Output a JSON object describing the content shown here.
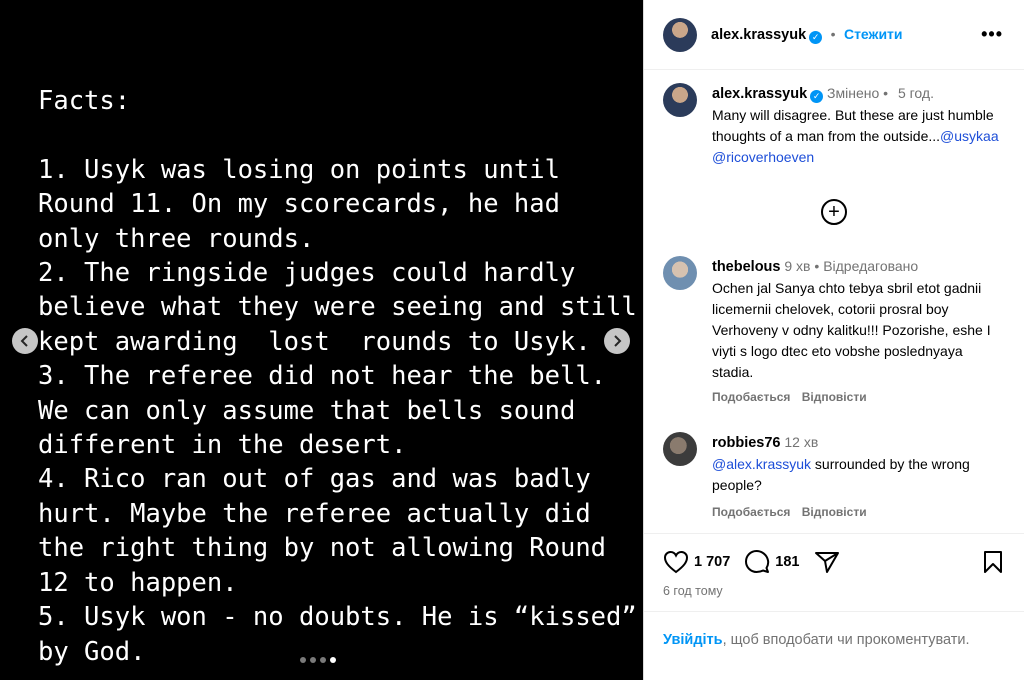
{
  "post_image": {
    "text": "Facts:\n\n1. Usyk was losing on points until\nRound 11. On my scorecards, he had\nonly three rounds.\n2. The ringside judges could hardly\nbelieve what they were seeing and still\nkept awarding  lost  rounds to Usyk.\n3. The referee did not hear the bell.\nWe can only assume that bells sound\ndifferent in the desert.\n4. Rico ran out of gas and was badly\nhurt. Maybe the referee actually did\nthe right thing by not allowing Round\n12 to happen.\n5. Usyk won - no doubts. He is “kissed”\nby God.",
    "carousel_dots": 4,
    "active_dot": 4
  },
  "header": {
    "username": "alex.krassyuk",
    "separator": "•",
    "follow_label": "Стежити",
    "more_label": "•••"
  },
  "caption": {
    "username": "alex.krassyuk",
    "edited": "Змінено",
    "separator": "•",
    "time": "5 год.",
    "text": "Many will disagree. But these are just humble thoughts of a man from the outside...",
    "mention_1": "@usykaa",
    "mention_2": "@ricoverhoeven"
  },
  "comments": [
    {
      "username": "thebelous",
      "time": "9 хв",
      "separator": "•",
      "edited": "Відредаговано",
      "text": "Ochen jal Sanya chto tebya sbril etot gadnii licemernii chelovek, cotorii prosral boy Verhoveny v odny kalitku!!! Pozorishe, eshe I viyti s logo dtec eto vobshe poslednyaya stadia.",
      "like_label": "Подобається",
      "reply_label": "Відповісти"
    },
    {
      "username": "robbies76",
      "time": "12 хв",
      "mention": "@alex.krassyuk",
      "text": " surrounded by the wrong people?",
      "like_label": "Подобається",
      "reply_label": "Відповісти"
    }
  ],
  "actions": {
    "likes": "1 707",
    "comments": "181"
  },
  "post_time": "6 год тому",
  "login_prompt": {
    "cta": "Увійдіть",
    "rest": ", щоб вподобати чи прокоментувати."
  }
}
